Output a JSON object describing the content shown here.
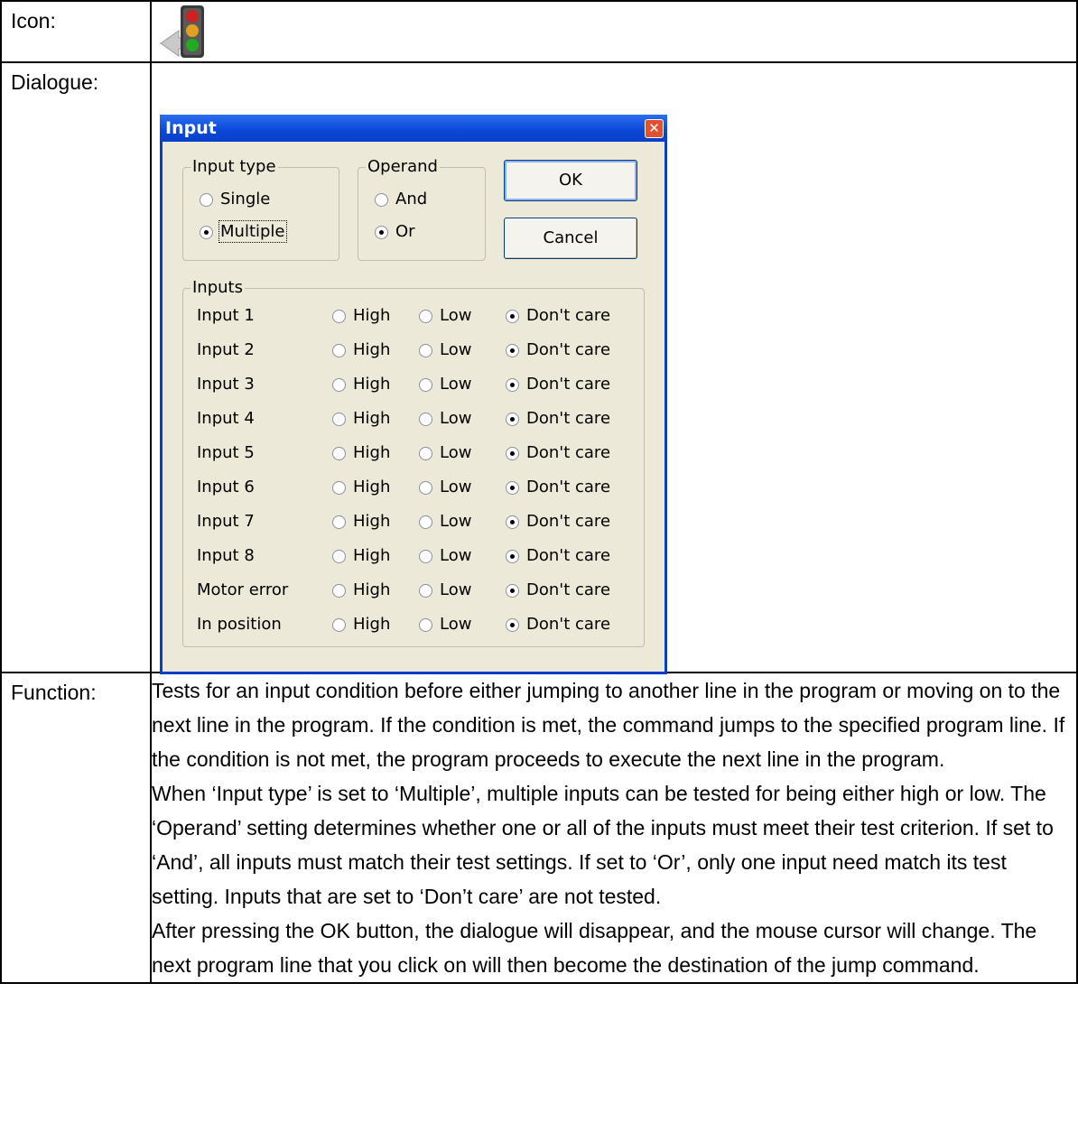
{
  "table": {
    "icon_label": "Icon:",
    "dialogue_label": "Dialogue:",
    "function_label": "Function:",
    "function_paragraphs": [
      "Tests for an input condition before either jumping to another line in the program or moving on to the next line in the program. If the condition is met, the command jumps to the specified program line. If the condition is not met, the program proceeds to execute the next line in the program.",
      "When ‘Input type’ is set to ‘Multiple’, multiple inputs can be tested for being either high or low. The ‘Operand’ setting determines whether one or all of the inputs must meet their test criterion. If set to ‘And’, all inputs must match their test settings. If set to ‘Or’, only one input need match its test setting. Inputs that are set to ‘Don’t care’ are not tested.",
      "After pressing the OK button, the dialogue will disappear, and the mouse cursor will change. The next program line that you click on will then become the destination of the jump command."
    ]
  },
  "icon": {
    "name": "traffic-light-jump-icon",
    "colors": [
      "#cc2222",
      "#e0a020",
      "#22aa22"
    ]
  },
  "dialog": {
    "title": "Input",
    "close_glyph": "✕",
    "input_type": {
      "title": "Input type",
      "options": [
        "Single",
        "Multiple"
      ],
      "selected": "Multiple"
    },
    "operand": {
      "title": "Operand",
      "options": [
        "And",
        "Or"
      ],
      "selected": "Or"
    },
    "ok_label": "OK",
    "cancel_label": "Cancel",
    "inputs_group": {
      "title": "Inputs",
      "high_label": "High",
      "low_label": "Low",
      "dont_care_label": "Don't care",
      "rows": [
        {
          "label": "Input 1",
          "selected": "dont_care"
        },
        {
          "label": "Input 2",
          "selected": "dont_care"
        },
        {
          "label": "Input 3",
          "selected": "dont_care"
        },
        {
          "label": "Input 4",
          "selected": "dont_care"
        },
        {
          "label": "Input 5",
          "selected": "dont_care"
        },
        {
          "label": "Input 6",
          "selected": "dont_care"
        },
        {
          "label": "Input 7",
          "selected": "dont_care"
        },
        {
          "label": "Input 8",
          "selected": "dont_care"
        },
        {
          "label": "Motor error",
          "selected": "dont_care"
        },
        {
          "label": "In position",
          "selected": "dont_care"
        }
      ]
    }
  }
}
